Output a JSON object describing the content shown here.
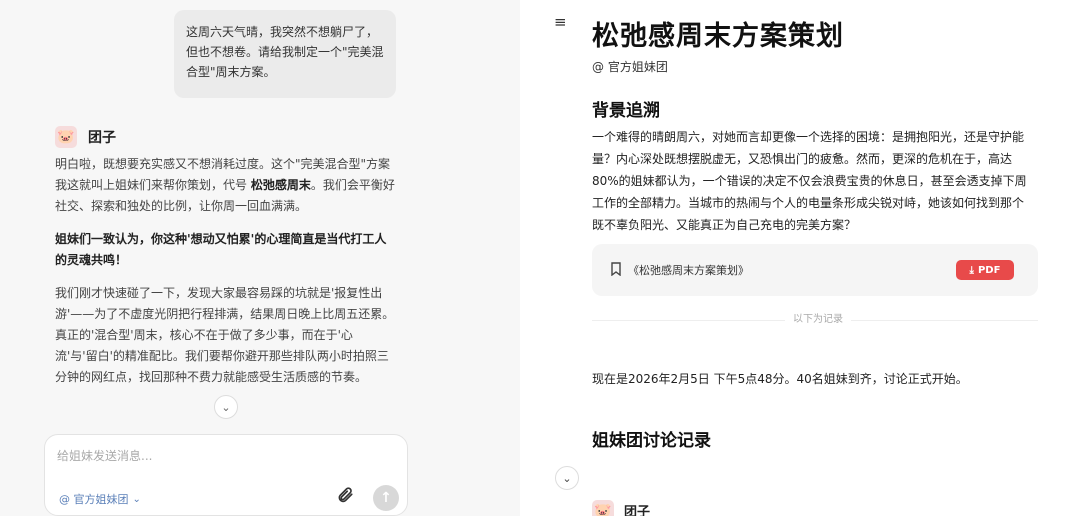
{
  "chat": {
    "user_message": "这周六天气晴，我突然不想躺尸了，但也不想卷。请给我制定一个\"完美混合型\"周末方案。",
    "bot": {
      "avatar_emoji": "🐷",
      "name": "团子",
      "para1_a": "明白啦，既想要充实感又不想消耗过度。这个\"完美混合型\"方案我这就叫上姐妹们来帮你策划，代号",
      "para1_bold": "松弛感周末",
      "para1_b": "。我们会平衡好社交、探索和独处的比例，让你周一回血满满。",
      "para2": "姐妹们一致认为，你这种'想动又怕累'的心理简直是当代打工人的灵魂共鸣！",
      "para3": "我们刚才快速碰了一下，发现大家最容易踩的坑就是'报复性出游'——为了不虚度光阴把行程排满，结果周日晚上比周五还累。真正的'混合型'周末，核心不在于做了多少事，而在于'心流'与'留白'的精准配比。我们要帮你避开那些排队两小时拍照三分钟的网红点，找回那种不费力就能感受生活质感的节奏。"
    },
    "scroll_icon": "chevron-down-icon",
    "composer": {
      "placeholder": "给姐妹发送消息...",
      "mention": "@ 官方姐妹团",
      "mention_caret": "⌄"
    }
  },
  "doc": {
    "title": "松弛感周末方案策划",
    "author": "@ 官方姐妹团",
    "section1_heading": "背景追溯",
    "section1_text": "一个难得的晴朗周六，对她而言却更像一个选择的困境：是拥抱阳光，还是守护能量？内心深处既想摆脱虚无，又恐惧出门的疲惫。然而，更深的危机在于，高达80%的姐妹都认为，一个错误的决定不仅会浪费宝贵的休息日，甚至会透支掉下周工作的全部精力。当城市的热闹与个人的电量条形成尖锐对峙，她该如何找到那个既不辜负阳光、又能真正为自己充电的完美方案？",
    "file_name": "《松弛感周末方案策划》",
    "pdf_label": "PDF",
    "divider_label": "以下为记录",
    "status_line": "现在是2026年2月5日 下午5点48分。40名姐妹到齐，讨论正式开始。",
    "section2_heading": "姐妹团讨论记录",
    "discussion_first_name": "团子"
  },
  "colors": {
    "pdf_button": "#e84a4a",
    "mention": "#5a7fb8"
  }
}
